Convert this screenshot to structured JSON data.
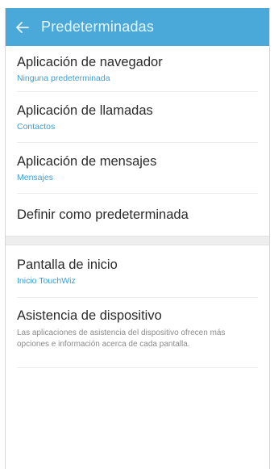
{
  "appbar": {
    "back_icon": "arrow-left-icon",
    "title": "Predeterminadas"
  },
  "section1": {
    "items": [
      {
        "title": "Aplicación de navegador",
        "subtitle": "Ninguna predeterminada"
      },
      {
        "title": "Aplicación de llamadas",
        "subtitle": "Contactos"
      },
      {
        "title": "Aplicación de mensajes",
        "subtitle": "Mensajes"
      },
      {
        "title": "Definir como predeterminada"
      }
    ]
  },
  "section2": {
    "items": [
      {
        "title": "Pantalla de inicio",
        "subtitle": "Inicio TouchWiz"
      },
      {
        "title": "Asistencia de dispositivo",
        "description": "Las aplicaciones de asistencia del dispositivo ofrecen más opciones e información acerca de cada pantalla."
      }
    ]
  },
  "colors": {
    "appbar": "#4aa9d9",
    "accent_subtitle": "#3a9fd6"
  }
}
